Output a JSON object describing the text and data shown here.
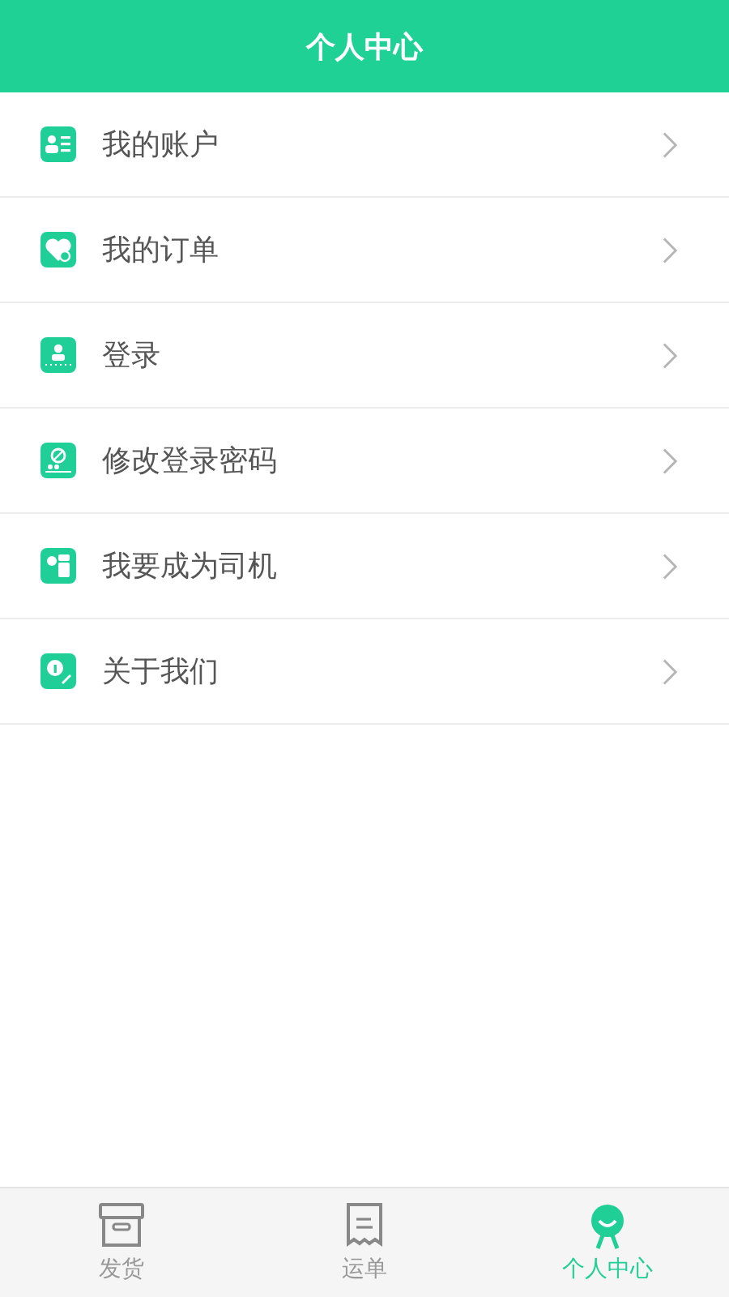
{
  "header": {
    "title": "个人中心"
  },
  "menu": [
    {
      "label": "我的账户"
    },
    {
      "label": "我的订单"
    },
    {
      "label": "登录"
    },
    {
      "label": "修改登录密码"
    },
    {
      "label": "我要成为司机"
    },
    {
      "label": "关于我们"
    }
  ],
  "tabs": [
    {
      "label": "发货",
      "selected": false
    },
    {
      "label": "运单",
      "selected": false
    },
    {
      "label": "个人中心",
      "selected": true
    }
  ]
}
